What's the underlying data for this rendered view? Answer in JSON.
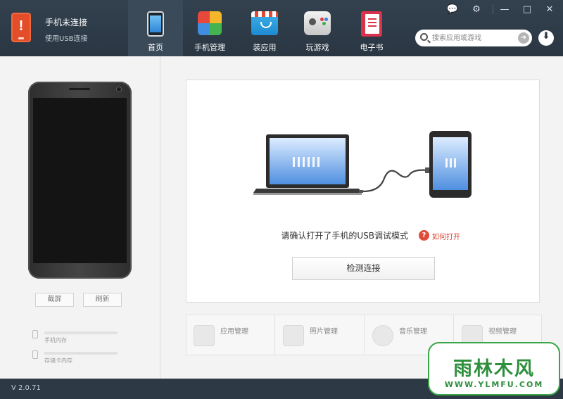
{
  "header": {
    "connection_title": "手机未连接",
    "connection_subtitle": "使用USB连接",
    "tabs": [
      {
        "label": "首页",
        "icon": "home-phone-icon",
        "active": true
      },
      {
        "label": "手机管理",
        "icon": "phone-manage-icon",
        "active": false
      },
      {
        "label": "装应用",
        "icon": "app-store-icon",
        "active": false
      },
      {
        "label": "玩游戏",
        "icon": "gamepad-icon",
        "active": false
      },
      {
        "label": "电子书",
        "icon": "ebook-icon",
        "active": false
      }
    ],
    "window_buttons": {
      "feedback": "💬",
      "settings": "⚙",
      "minimize": "—",
      "maximize": "□",
      "close": "✕"
    },
    "search": {
      "placeholder": "搜索应用或游戏",
      "go": "➜"
    },
    "download": "⬇"
  },
  "left_panel": {
    "screenshot_button": "截屏",
    "refresh_button": "刷新",
    "phone_storage_label": "手机内存",
    "sd_storage_label": "存储卡内存"
  },
  "main": {
    "usb_instruction": "请确认打开了手机的USB调试模式",
    "help_icon": "?",
    "help_link": "如何打开",
    "detect_button": "检测连接",
    "quick_actions": [
      {
        "label": "应用管理",
        "icon": "app-grid-icon"
      },
      {
        "label": "照片管理",
        "icon": "photo-icon"
      },
      {
        "label": "音乐管理",
        "icon": "music-note-icon"
      },
      {
        "label": "视频管理",
        "icon": "video-icon"
      }
    ]
  },
  "status_bar": {
    "version": "V 2.0.71"
  },
  "watermark": {
    "brand": "雨林木风",
    "url": "WWW.YLMFU.COM"
  },
  "colors": {
    "header_bg": "#2a3642",
    "active_tab": "#3b4a59",
    "alert_orange": "#e34d2a",
    "help_red": "#d9402c",
    "screen_blue": "#4f8fe0",
    "watermark_green": "#2e8f3d"
  }
}
